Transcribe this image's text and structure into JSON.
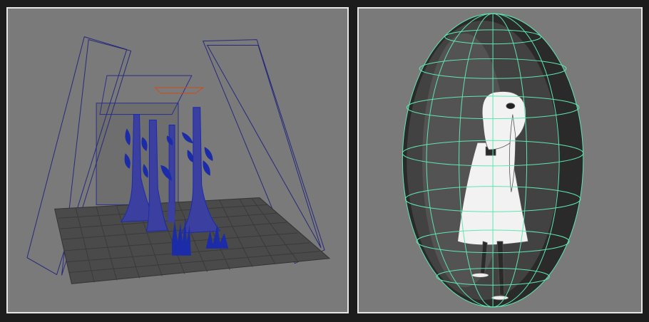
{
  "viewports": [
    {
      "id": "left",
      "content": "scene-wireframe-with-trees-and-cameras",
      "background": "#7a7a7a",
      "colors": {
        "wire": "#2b2f8a",
        "foliage": "#1c2ca8",
        "grid": "#3a3a3a",
        "frame": "#26297a",
        "locator": "#d04a1a"
      }
    },
    {
      "id": "right",
      "content": "character-with-ellipsoid-wireframe-cage",
      "background": "#7a7a7a",
      "colors": {
        "cage": "#5fe6b0",
        "shell": "#1e1e1e",
        "character": "#f0f0f0"
      }
    }
  ]
}
